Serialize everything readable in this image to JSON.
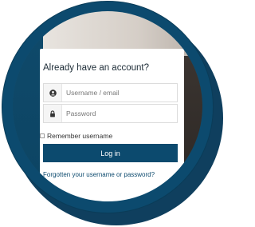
{
  "login": {
    "heading": "Already have an account?",
    "username_placeholder": "Username / email",
    "password_placeholder": "Password",
    "remember_label": "Remember username",
    "remember_checked": false,
    "login_button": "Log in",
    "forgot_link": "Forgotten your username or password?",
    "user_icon": "user-circle-icon",
    "lock_icon": "lock-icon"
  },
  "colors": {
    "brand": "#0c4a6e",
    "ring_shadow": "#0f3f5e"
  }
}
